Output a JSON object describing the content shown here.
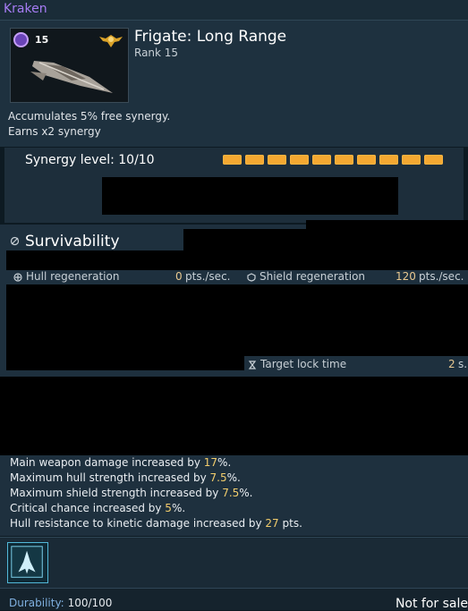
{
  "window": {
    "title": "Kraken"
  },
  "ship": {
    "name": "Frigate: Long Range",
    "rank_label": "Rank 15",
    "rank_number": "15",
    "descriptions": [
      "Accumulates 5% free synergy.",
      "Earns x2 synergy"
    ]
  },
  "synergy": {
    "label": "Synergy level: 10/10",
    "level": 10,
    "max": 10,
    "color": "#f4a831"
  },
  "survivability": {
    "title": "Survivability",
    "stats": [
      {
        "label": "Hull regeneration",
        "value": "0",
        "unit": "pts./sec."
      },
      {
        "label": "Shield regeneration",
        "value": "120",
        "unit": "pts./sec."
      },
      {
        "label": "Target lock time",
        "value": "2",
        "unit": "s."
      }
    ]
  },
  "bonuses": [
    {
      "pre": "Main weapon damage increased by ",
      "value": "17",
      "post": "%."
    },
    {
      "pre": "Maximum hull strength increased by ",
      "value": "7.5",
      "post": "%."
    },
    {
      "pre": "Maximum shield strength increased by ",
      "value": "7.5",
      "post": "%."
    },
    {
      "pre": "Critical chance increased by ",
      "value": "5",
      "post": "%."
    },
    {
      "pre": "Hull resistance to kinetic damage increased by ",
      "value": "27",
      "post": " pts."
    }
  ],
  "footer": {
    "durability_label": "Durability:",
    "durability_value": "100/100",
    "sale": "Not for sale"
  },
  "colors": {
    "title": "#a67cf4",
    "highlight": "#f2cd6c",
    "panel": "#1e303e"
  }
}
